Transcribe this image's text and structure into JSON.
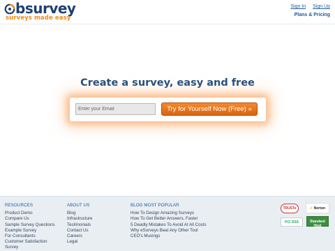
{
  "brand": {
    "name": "bsurvey",
    "tagline": "surveys made easy",
    "colors": {
      "primary": "#1e4b7c",
      "accent": "#f07a1c",
      "link": "#1f5a96"
    }
  },
  "header": {
    "sign_in": "Sign In",
    "sign_up": "Sign Up",
    "plans_pricing": "Plans & Pricing"
  },
  "hero": {
    "title": "Create a survey, easy and free",
    "email_placeholder": "Enter your Email",
    "email_value": "",
    "cta_label": "Try for Yourself Now (Free) »"
  },
  "footer": {
    "resources": {
      "heading": "RESOURCES",
      "items": [
        "Product Demo",
        "Compare Us",
        "Sample Survey Questions",
        "Example Survey",
        "For Consultants",
        "Customer Satisfaction Survey"
      ]
    },
    "about": {
      "heading": "ABOUT US",
      "items": [
        "Blog",
        "Infrastructure",
        "Testimonials",
        "Contact Us",
        "Careers",
        "Legal"
      ]
    },
    "blog": {
      "heading": "BLOG MOST POPULAR",
      "items": [
        "How To Design Amazing Surveys",
        "How To Get Better Answers, Faster",
        "5 Deadly Mistakes To Avoid At All Costs",
        "Why eSurveys Beat Any Other Tool",
        "CEO's Musings"
      ]
    },
    "badges": {
      "truste": "TRUSTe",
      "norton": "Norton",
      "pci": "PCI DSS",
      "green": "Standard Host"
    }
  }
}
